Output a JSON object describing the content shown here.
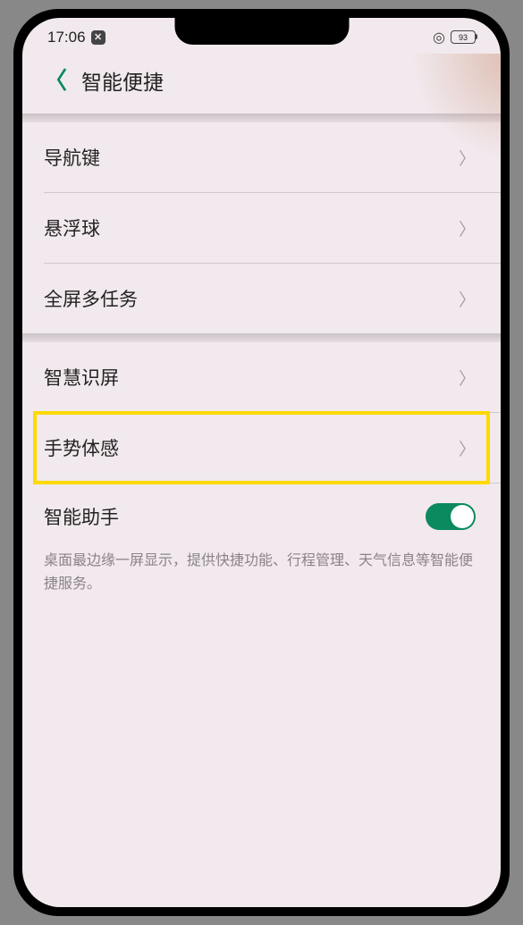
{
  "statusBar": {
    "time": "17:06",
    "battery": "93"
  },
  "header": {
    "title": "智能便捷"
  },
  "items": {
    "nav": "导航键",
    "float": "悬浮球",
    "fullscreen": "全屏多任务",
    "smart": "智慧识屏",
    "gesture": "手势体感",
    "assistant": "智能助手"
  },
  "description": "桌面最边缘一屏显示，提供快捷功能、行程管理、天气信息等智能便捷服务。"
}
